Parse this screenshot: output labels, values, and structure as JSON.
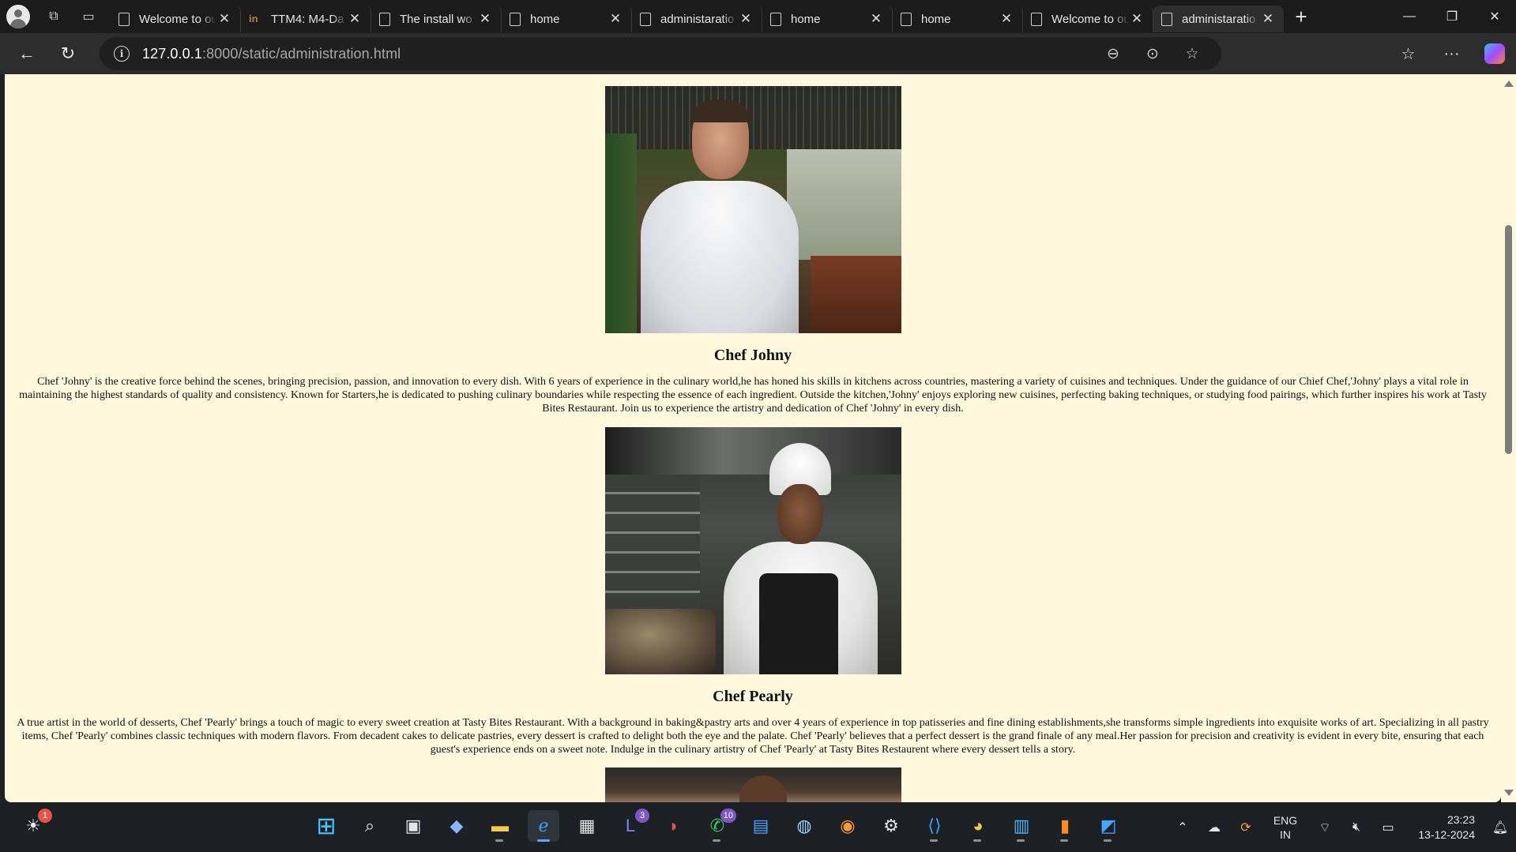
{
  "browser": {
    "tabs": [
      {
        "label": "Welcome to our",
        "icon": "page-icon",
        "active": false
      },
      {
        "label": "TTM4: M4-Da",
        "icon": "tm-logo-icon",
        "active": false
      },
      {
        "label": "The install wo",
        "icon": "page-icon",
        "active": false
      },
      {
        "label": "home",
        "icon": "page-icon",
        "active": false
      },
      {
        "label": "administaratio",
        "icon": "page-icon",
        "active": false
      },
      {
        "label": "home",
        "icon": "page-icon",
        "active": false
      },
      {
        "label": "home",
        "icon": "page-icon",
        "active": false
      },
      {
        "label": "Welcome to our",
        "icon": "page-icon",
        "active": false
      },
      {
        "label": "administaratio",
        "icon": "page-icon",
        "active": true
      }
    ],
    "url_host": "127.0.0.1",
    "url_rest": ":8000/static/administration.html"
  },
  "page": {
    "background": "#fff8dc",
    "chefs": [
      {
        "name": "Chef Johny",
        "bio": "Chef 'Johny' is the creative force behind the scenes, bringing precision, passion, and innovation to every dish. With 6 years of experience in the culinary world,he has honed his skills in kitchens across countries, mastering a variety of cuisines and techniques. Under the guidance of our Chief Chef,'Johny' plays a vital role in maintaining the highest standards of quality and consistency. Known for Starters,he is dedicated to pushing culinary boundaries while respecting the essence of each ingredient. Outside the kitchen,'Johny' enjoys exploring new cuisines, perfecting baking techniques, or studying food pairings, which further inspires his work at Tasty Bites Restaurant. Join us to experience the artistry and dedication of Chef 'Johny' in every dish."
      },
      {
        "name": "Chef Pearly",
        "bio": "A true artist in the world of desserts, Chef 'Pearly' brings a touch of magic to every sweet creation at Tasty Bites Restaurant. With a background in baking&pastry arts and over 4 years of experience in top patisseries and fine dining establishments,she transforms simple ingredients into exquisite works of art. Specializing in all pastry items, Chef 'Pearly' combines classic techniques with modern flavors. From decadent cakes to delicate pastries, every dessert is crafted to delight both the eye and the palate. Chef 'Pearly' believes that a perfect dessert is the grand finale of any meal.Her passion for precision and creativity is evident in every bite, ensuring that each guest's experience ends on a sweet note. Indulge in the culinary artistry of Chef 'Pearly' at Tasty Bites Restaurent where every dessert tells a story."
      }
    ]
  },
  "taskbar": {
    "weather_badge": "1",
    "teams_badge": "3",
    "whatsapp_badge": "10",
    "language_line1": "ENG",
    "language_line2": "IN",
    "time": "23:23",
    "date": "13-12-2024"
  }
}
